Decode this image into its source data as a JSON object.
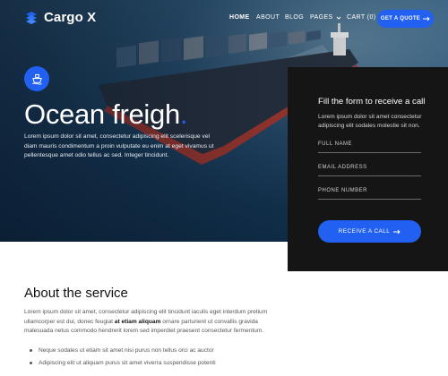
{
  "brand": {
    "name": "Cargo X",
    "icon": "cargo-logo-icon",
    "accent": "#2160F0"
  },
  "nav": {
    "items": [
      "HOME",
      "ABOUT",
      "BLOG",
      "PAGES",
      "CART (0)"
    ],
    "active": "HOME",
    "quote_button": "GET A QUOTE"
  },
  "hero": {
    "icon": "ship-icon",
    "title": "Ocean freigh",
    "title_dot": ".",
    "text": "Lorem ipsum dolor sit amet, consectetur adipiscing elit scelerisque vel diam mauris condimentum a proin vulputate eu enim at eget vivamus ut pellentesque amet odio tellus ac sed. Integer tincidunt."
  },
  "form": {
    "title": "Fill the form to receive a call",
    "subtitle": "Lorem ipsum dolor sit amet consectetur adipiscing elit sodales molestie sit non.",
    "fields": [
      "FULL NAME",
      "EMAIL ADDRESS",
      "PHONE NUMBER"
    ],
    "submit": "RECEIVE A CALL"
  },
  "about": {
    "title": "About the service",
    "text_before": "Lorem ipsum dolor sit amet, consectetur adipiscing elit tincidunt iaculis eget interdum pretium ullamcorper est dui, donec feugiat ",
    "text_bold": "at etiam aliquam",
    "text_after": " ornare parturient ut convallis gravida malesuada netus commodo hendrerit lorem sed imperdiet praesent consectetur fermentum.",
    "bullets": [
      "Neque sodales ut etiam sit amet nisi purus non tellus orci ac auctor",
      "Adipiscing elit ut aliquam purus sit amet viverra suspendisse potenti"
    ]
  }
}
